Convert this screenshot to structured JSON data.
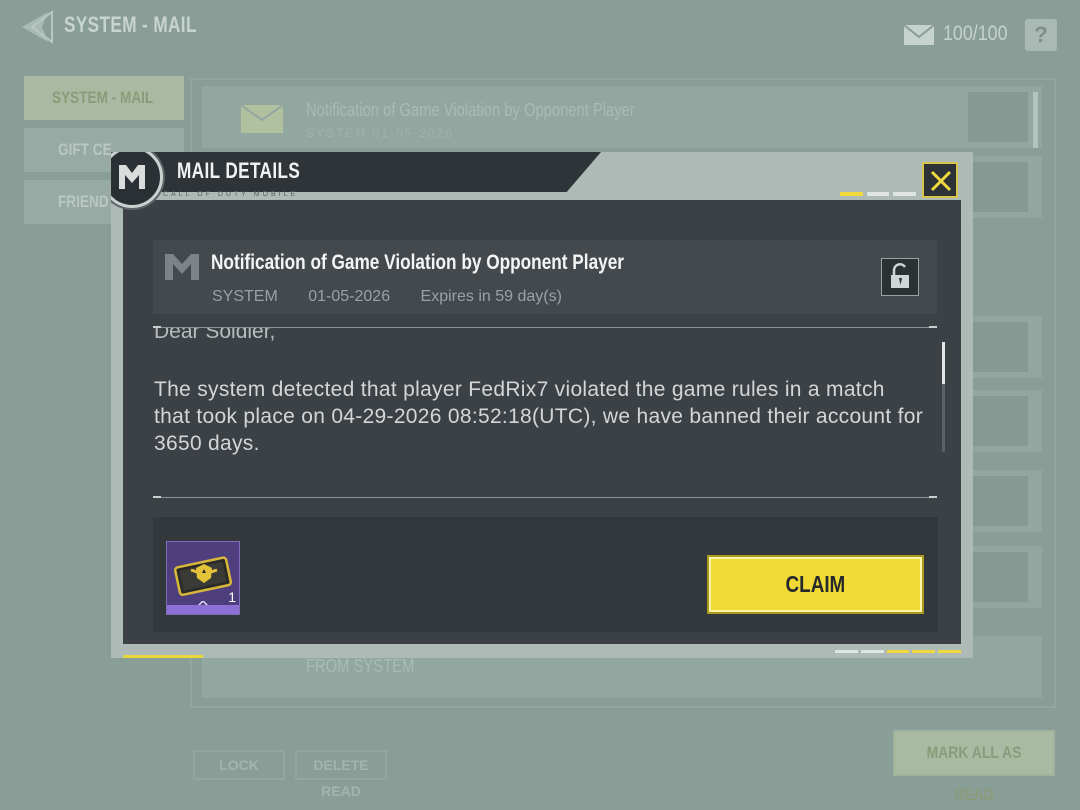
{
  "background": {
    "title": "SYSTEM - MAIL",
    "mail_count": "100/100",
    "help_label": "?",
    "sidebar": [
      {
        "label": "SYSTEM - MAIL",
        "active": true
      },
      {
        "label": "GIFT CE",
        "active": false
      },
      {
        "label": "FRIEND",
        "active": false
      }
    ],
    "list_rows": [
      {
        "title": "Notification of Game Violation by Opponent Player",
        "meta": "SYSTEM 01-05-2026"
      },
      {
        "title": "",
        "meta": ""
      },
      {
        "title": "",
        "meta": ""
      },
      {
        "title": "",
        "meta": ""
      },
      {
        "title": "",
        "meta": ""
      },
      {
        "title": "",
        "meta": ""
      },
      {
        "title": "",
        "meta": ""
      },
      {
        "title": "FROM SYSTEM",
        "meta": ""
      }
    ],
    "buttons": {
      "lock": "LOCK",
      "delete_read": "DELETE READ",
      "mark_all": "MARK ALL AS READ"
    }
  },
  "modal": {
    "title": "MAIL DETAILS",
    "subtitle": "CALL OF DUTY MOBILE",
    "close_icon": "close-x-icon",
    "mail": {
      "subject": "Notification of Game Violation by Opponent Player",
      "sender": "SYSTEM",
      "date": "01-05-2026",
      "expires": "Expires in 59 day(s)",
      "greeting": "Dear Soldier,",
      "body": "The system detected that player FedRix7 violated the game rules in a match that took place on 04-29-2026 08:52:18(UTC), we have banned their account for 3650 days."
    },
    "reward": {
      "icon": "ticket-card-icon",
      "quantity": "1",
      "rarity_color": "#8c70d6"
    },
    "claim_label": "CLAIM",
    "accent_color": "#f1da35"
  }
}
